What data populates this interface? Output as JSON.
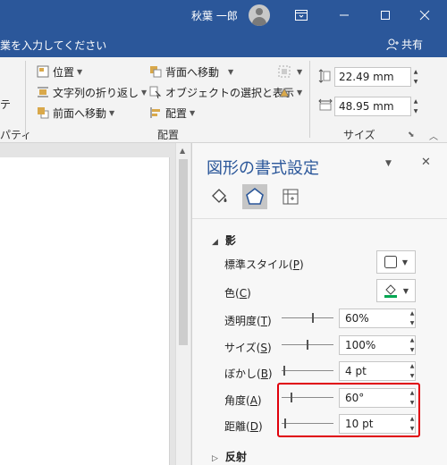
{
  "titlebar": {
    "user_name": "秋葉 一郎"
  },
  "tellbar": {
    "tell_me_text": "業を入力してください",
    "share_label": "共有"
  },
  "ribbon": {
    "left_partial": {
      "top_text": "テ",
      "bottom_text": "パティ"
    },
    "arrange": {
      "position": "位置",
      "wrap_text": "文字列の折り返し",
      "bring_forward": "前面へ移動",
      "send_backward": "背面へ移動",
      "selection_pane": "オブジェクトの選択と表示",
      "align": "配置",
      "group_label": "配置"
    },
    "size": {
      "height": "22.49 mm",
      "width": "48.95 mm",
      "group_label": "サイズ"
    }
  },
  "pane": {
    "title": "図形の書式設定",
    "tabs": [
      "fill-line-icon",
      "effects-icon",
      "layout-properties-icon"
    ],
    "sections": {
      "shadow": "影",
      "reflection": "反射"
    },
    "shadow_props": {
      "preset_label": "標準スタイル(",
      "preset_key": "P",
      "color_label": "色(",
      "color_key": "C",
      "color_value": "#00a651",
      "transparency_label": "透明度(",
      "transparency_key": "T",
      "transparency_value": "60%",
      "size_label": "サイズ(",
      "size_key": "S",
      "size_value": "100%",
      "blur_label": "ぼかし(",
      "blur_key": "B",
      "blur_value": "4 pt",
      "angle_label": "角度(",
      "angle_key": "A",
      "angle_value": "60°",
      "distance_label": "距離(",
      "distance_key": "D",
      "distance_value": "10 pt",
      "close_paren": ")"
    },
    "slider_levels": {
      "transparency": 0.6,
      "size": 0.5,
      "blur": 0.04,
      "angle": 0.17,
      "distance": 0.05
    }
  },
  "colors": {
    "accent": "#2b579a",
    "highlight": "#e0000b"
  }
}
